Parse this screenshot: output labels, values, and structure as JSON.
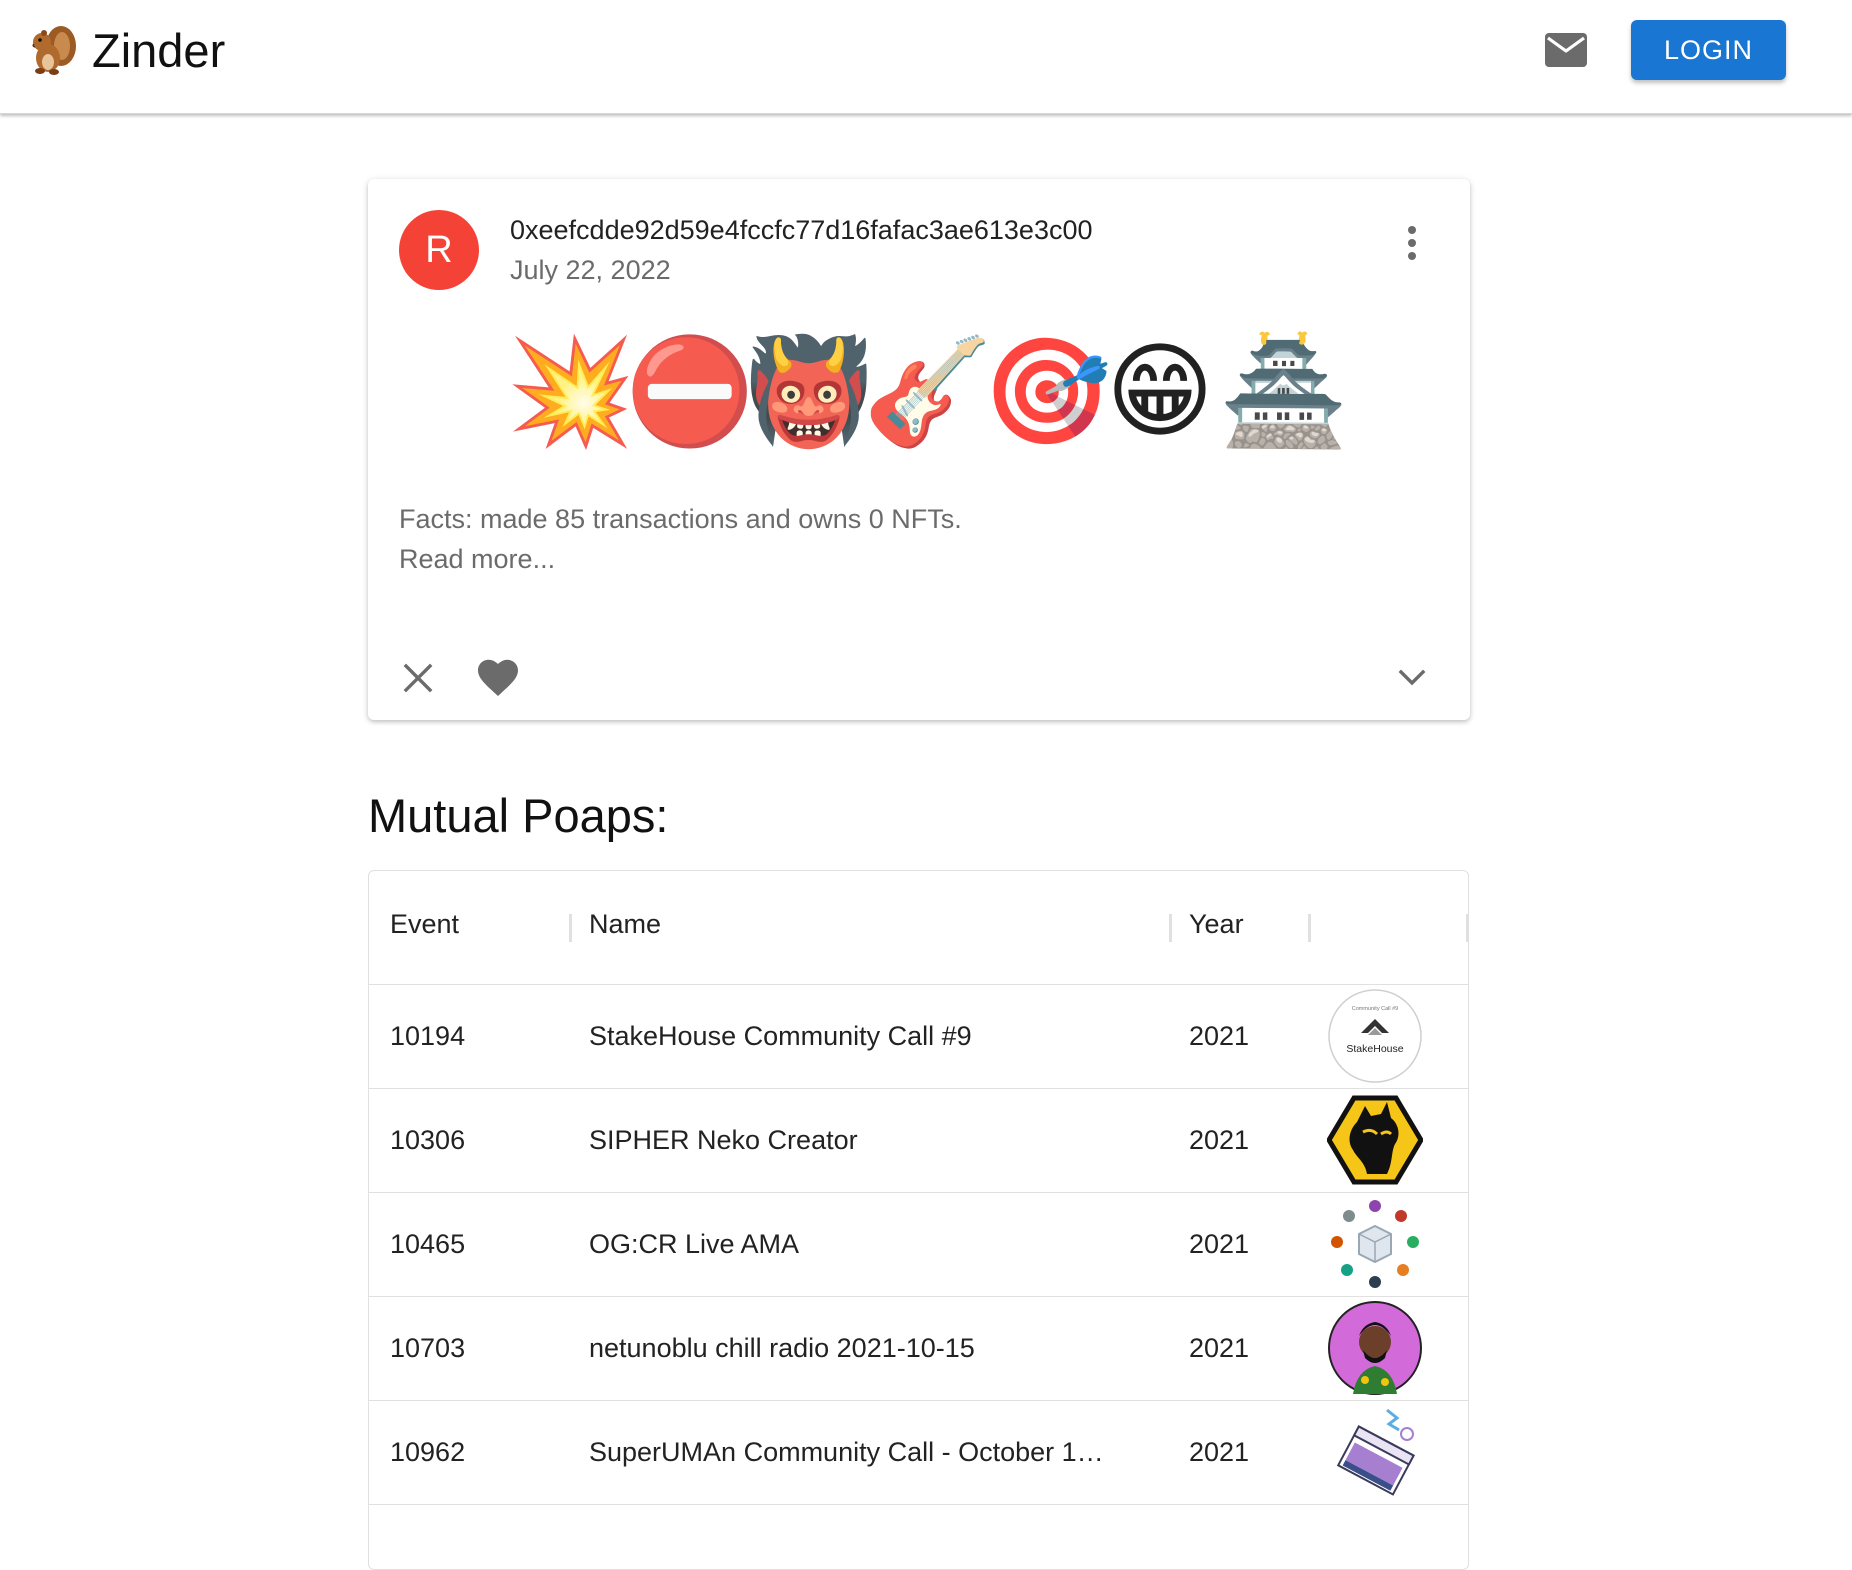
{
  "appbar": {
    "brand_name": "Zinder",
    "brand_icon": "chipmunk-icon",
    "mail_icon": "mail-icon",
    "login_label": "LOGIN",
    "accent": "#1976d2"
  },
  "profile_card": {
    "avatar_letter": "R",
    "avatar_color": "#f44336",
    "address": "0xeefcdde92d59e4fccfc77d16fafac3ae613e3c00",
    "date": "July 22, 2022",
    "emojis": [
      "💥",
      "⛔",
      "👹",
      "🎸",
      "🎯",
      "😁",
      "🏯"
    ],
    "facts_line": "Facts: made 85 transactions and owns 0 NFTs.",
    "read_more": "Read more...",
    "actions": [
      "close-icon",
      "heart-icon",
      "chevron-down-icon",
      "more-vert-icon"
    ]
  },
  "mutual_poaps": {
    "title": "Mutual Poaps:",
    "columns": [
      "Event",
      "Name",
      "Year",
      ""
    ],
    "rows": [
      {
        "event": "10194",
        "name": "StakeHouse Community Call #9",
        "year": "2021",
        "badge": "stakehouse-badge",
        "badge_text": "StakeHouse",
        "badge_subtext": "Community Call #9"
      },
      {
        "event": "10306",
        "name": "SIPHER Neko Creator",
        "year": "2021",
        "badge": "sipher-neko-badge"
      },
      {
        "event": "10465",
        "name": "OG:CR Live AMA",
        "year": "2021",
        "badge": "ogcr-badge"
      },
      {
        "event": "10703",
        "name": "netunoblu chill radio 2021-10-15",
        "year": "2021",
        "badge": "netunoblu-badge"
      },
      {
        "event": "10962",
        "name": "SuperUMAn Community Call - October 1…",
        "year": "2021",
        "badge": "superuman-badge"
      }
    ]
  }
}
